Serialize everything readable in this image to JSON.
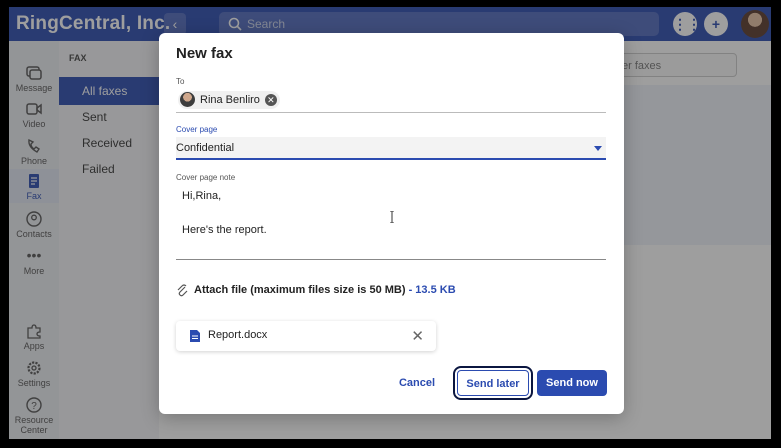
{
  "header": {
    "brand": "RingCentral, Inc.",
    "search_placeholder": "Search"
  },
  "rail": {
    "items": [
      {
        "label": "Message"
      },
      {
        "label": "Video"
      },
      {
        "label": "Phone"
      },
      {
        "label": "Fax"
      },
      {
        "label": "Contacts"
      },
      {
        "label": "More"
      },
      {
        "label": "Apps"
      },
      {
        "label": "Settings"
      },
      {
        "label": "Resource Center"
      }
    ]
  },
  "sidebar": {
    "section_title": "FAX",
    "items": [
      {
        "label": "All faxes"
      },
      {
        "label": "Sent"
      },
      {
        "label": "Received"
      },
      {
        "label": "Failed"
      }
    ]
  },
  "right": {
    "filter_placeholder": "er faxes"
  },
  "dialog": {
    "title": "New fax",
    "to_label": "To",
    "recipient": "Rina Benliro",
    "cover_label": "Cover page",
    "cover_value": "Confidential",
    "note_label": "Cover page note",
    "note_line1": "Hi,Rina,",
    "note_line2": "Here's the report.",
    "attach_text": "Attach file (maximum files size is 50 MB)",
    "attach_sep": " - ",
    "attach_size": "13.5 KB",
    "file_name": "Report.docx",
    "cancel": "Cancel",
    "send_later": "Send later",
    "send_now": "Send now"
  },
  "colors": {
    "brand": "#2b4bb0",
    "focus_ring": "#0b1640"
  }
}
